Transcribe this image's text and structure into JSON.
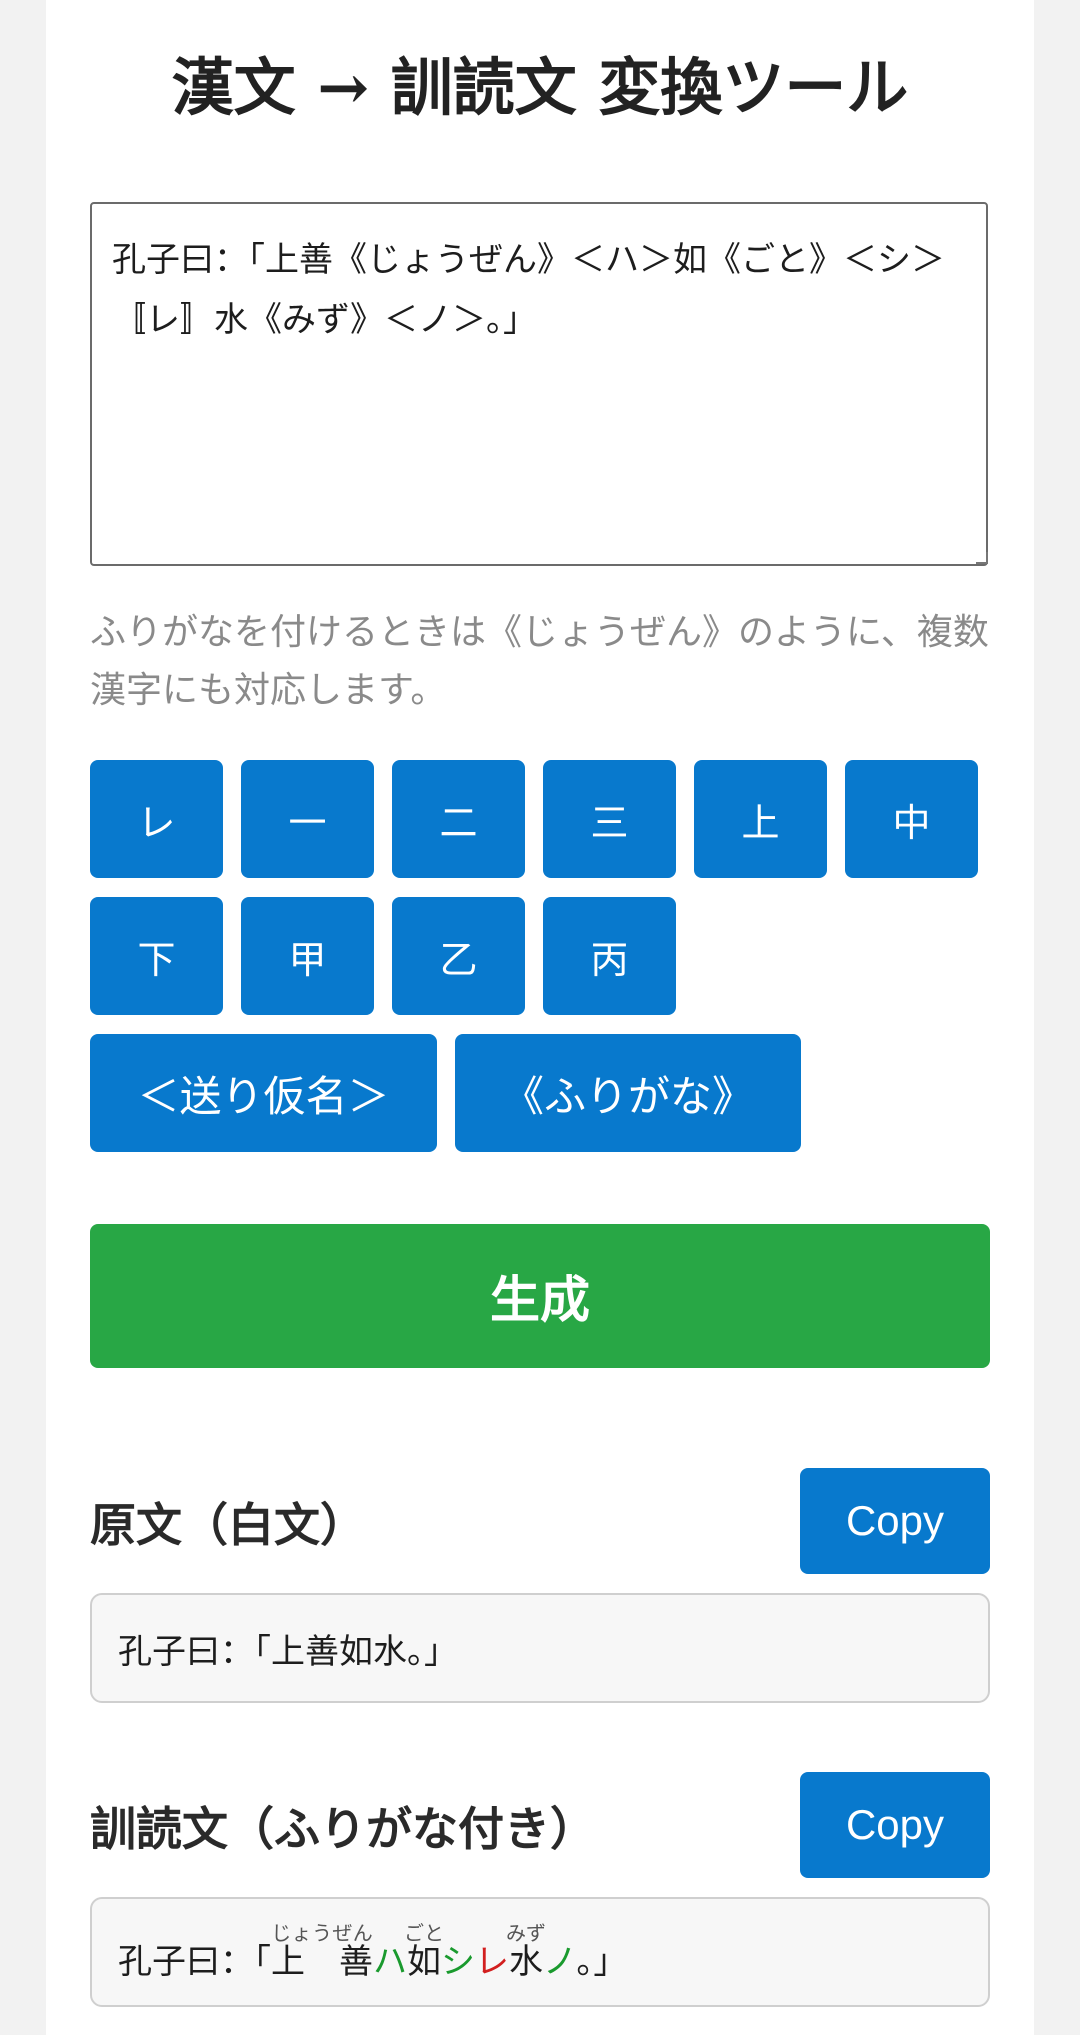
{
  "title": "漢文 → 訓読文 変換ツール",
  "editor": {
    "value": "孔子曰：「上善《じょうぜん》＜ハ＞如《ごと》＜シ＞〚レ〛水《みず》＜ノ＞。」"
  },
  "hint": "ふりがなを付けるときは《じょうぜん》のように、複数漢字にも対応します。",
  "kaeriten_buttons": [
    "レ",
    "一",
    "二",
    "三",
    "上",
    "中",
    "下",
    "甲",
    "乙",
    "丙"
  ],
  "okurigana_button": "＜送り仮名＞",
  "furigana_button": "《ふりがな》",
  "generate_button": "生成",
  "original_section": {
    "title": "原文（白文）",
    "copy_label": "Copy",
    "text": "孔子曰：「上善如水。」"
  },
  "kundoku_section": {
    "title": "訓読文（ふりがな付き）",
    "copy_label": "Copy",
    "prefix": "孔子曰：「",
    "ruby1_base": "上　善",
    "ruby1_text": "じょうぜん",
    "okuri1": "ハ",
    "ruby2_base": "如",
    "ruby2_text": "ごと",
    "okuri2": "シ",
    "kaeri1": "レ",
    "ruby3_base": "水",
    "ruby3_text": "みず",
    "okuri3": "ノ",
    "suffix": "。」"
  },
  "colors": {
    "primary_blue": "#0879cd",
    "generate_green": "#28a745",
    "okurigana_green": "#1a9a2e",
    "kaeriten_red": "#d21f1f"
  }
}
